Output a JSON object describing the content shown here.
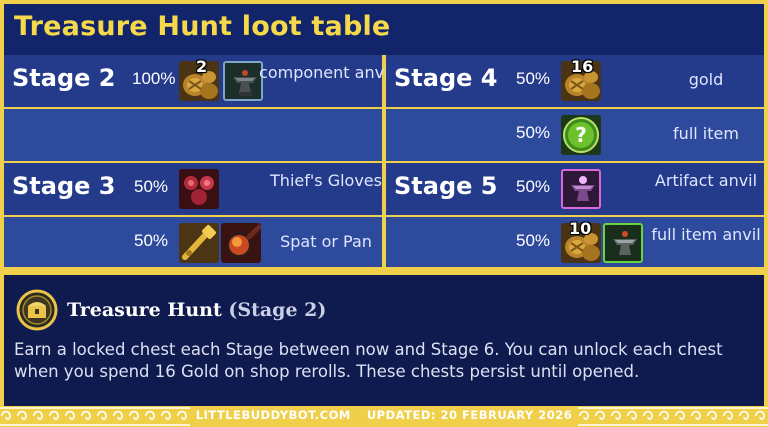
{
  "title": "Treasure Hunt loot table",
  "stages": {
    "s2": {
      "label": "Stage 2",
      "rows": [
        {
          "pct": "100%",
          "badge": "2",
          "text": "component anvil"
        }
      ]
    },
    "s3": {
      "label": "Stage 3",
      "rows": [
        {
          "pct": "50%",
          "text": "Thief's Gloves"
        },
        {
          "pct": "50%",
          "text": "Spat or Pan"
        }
      ]
    },
    "s4": {
      "label": "Stage 4",
      "rows": [
        {
          "pct": "50%",
          "badge": "16",
          "text": "gold"
        },
        {
          "pct": "50%",
          "text": "full item"
        }
      ]
    },
    "s5": {
      "label": "Stage 5",
      "rows": [
        {
          "pct": "50%",
          "text": "Artifact anvil"
        },
        {
          "pct": "50%",
          "badge": "10",
          "text": "full item anvil"
        }
      ]
    }
  },
  "description": {
    "name": "Treasure Hunt",
    "stage": "(Stage 2)",
    "body": "Earn a locked chest each Stage between now and Stage 6. You can unlock each chest when you spend 16 Gold on shop rerolls. These chests persist until opened."
  },
  "footer": {
    "site": "LITTLEBUDDYBOT.COM",
    "updated": "UPDATED: 20 FEBRUARY 2026"
  },
  "colors": {
    "background_navy": "#13256a",
    "accent_gold": "#f0cf4a",
    "title_yellow": "#f5d94a"
  },
  "icons": [
    "gold-coins-icon",
    "component-anvil-icon",
    "thiefs-gloves-icon",
    "spatula-icon",
    "frying-pan-icon",
    "question-orb-icon",
    "artifact-anvil-icon",
    "item-anvil-icon",
    "treasure-chest-icon"
  ]
}
